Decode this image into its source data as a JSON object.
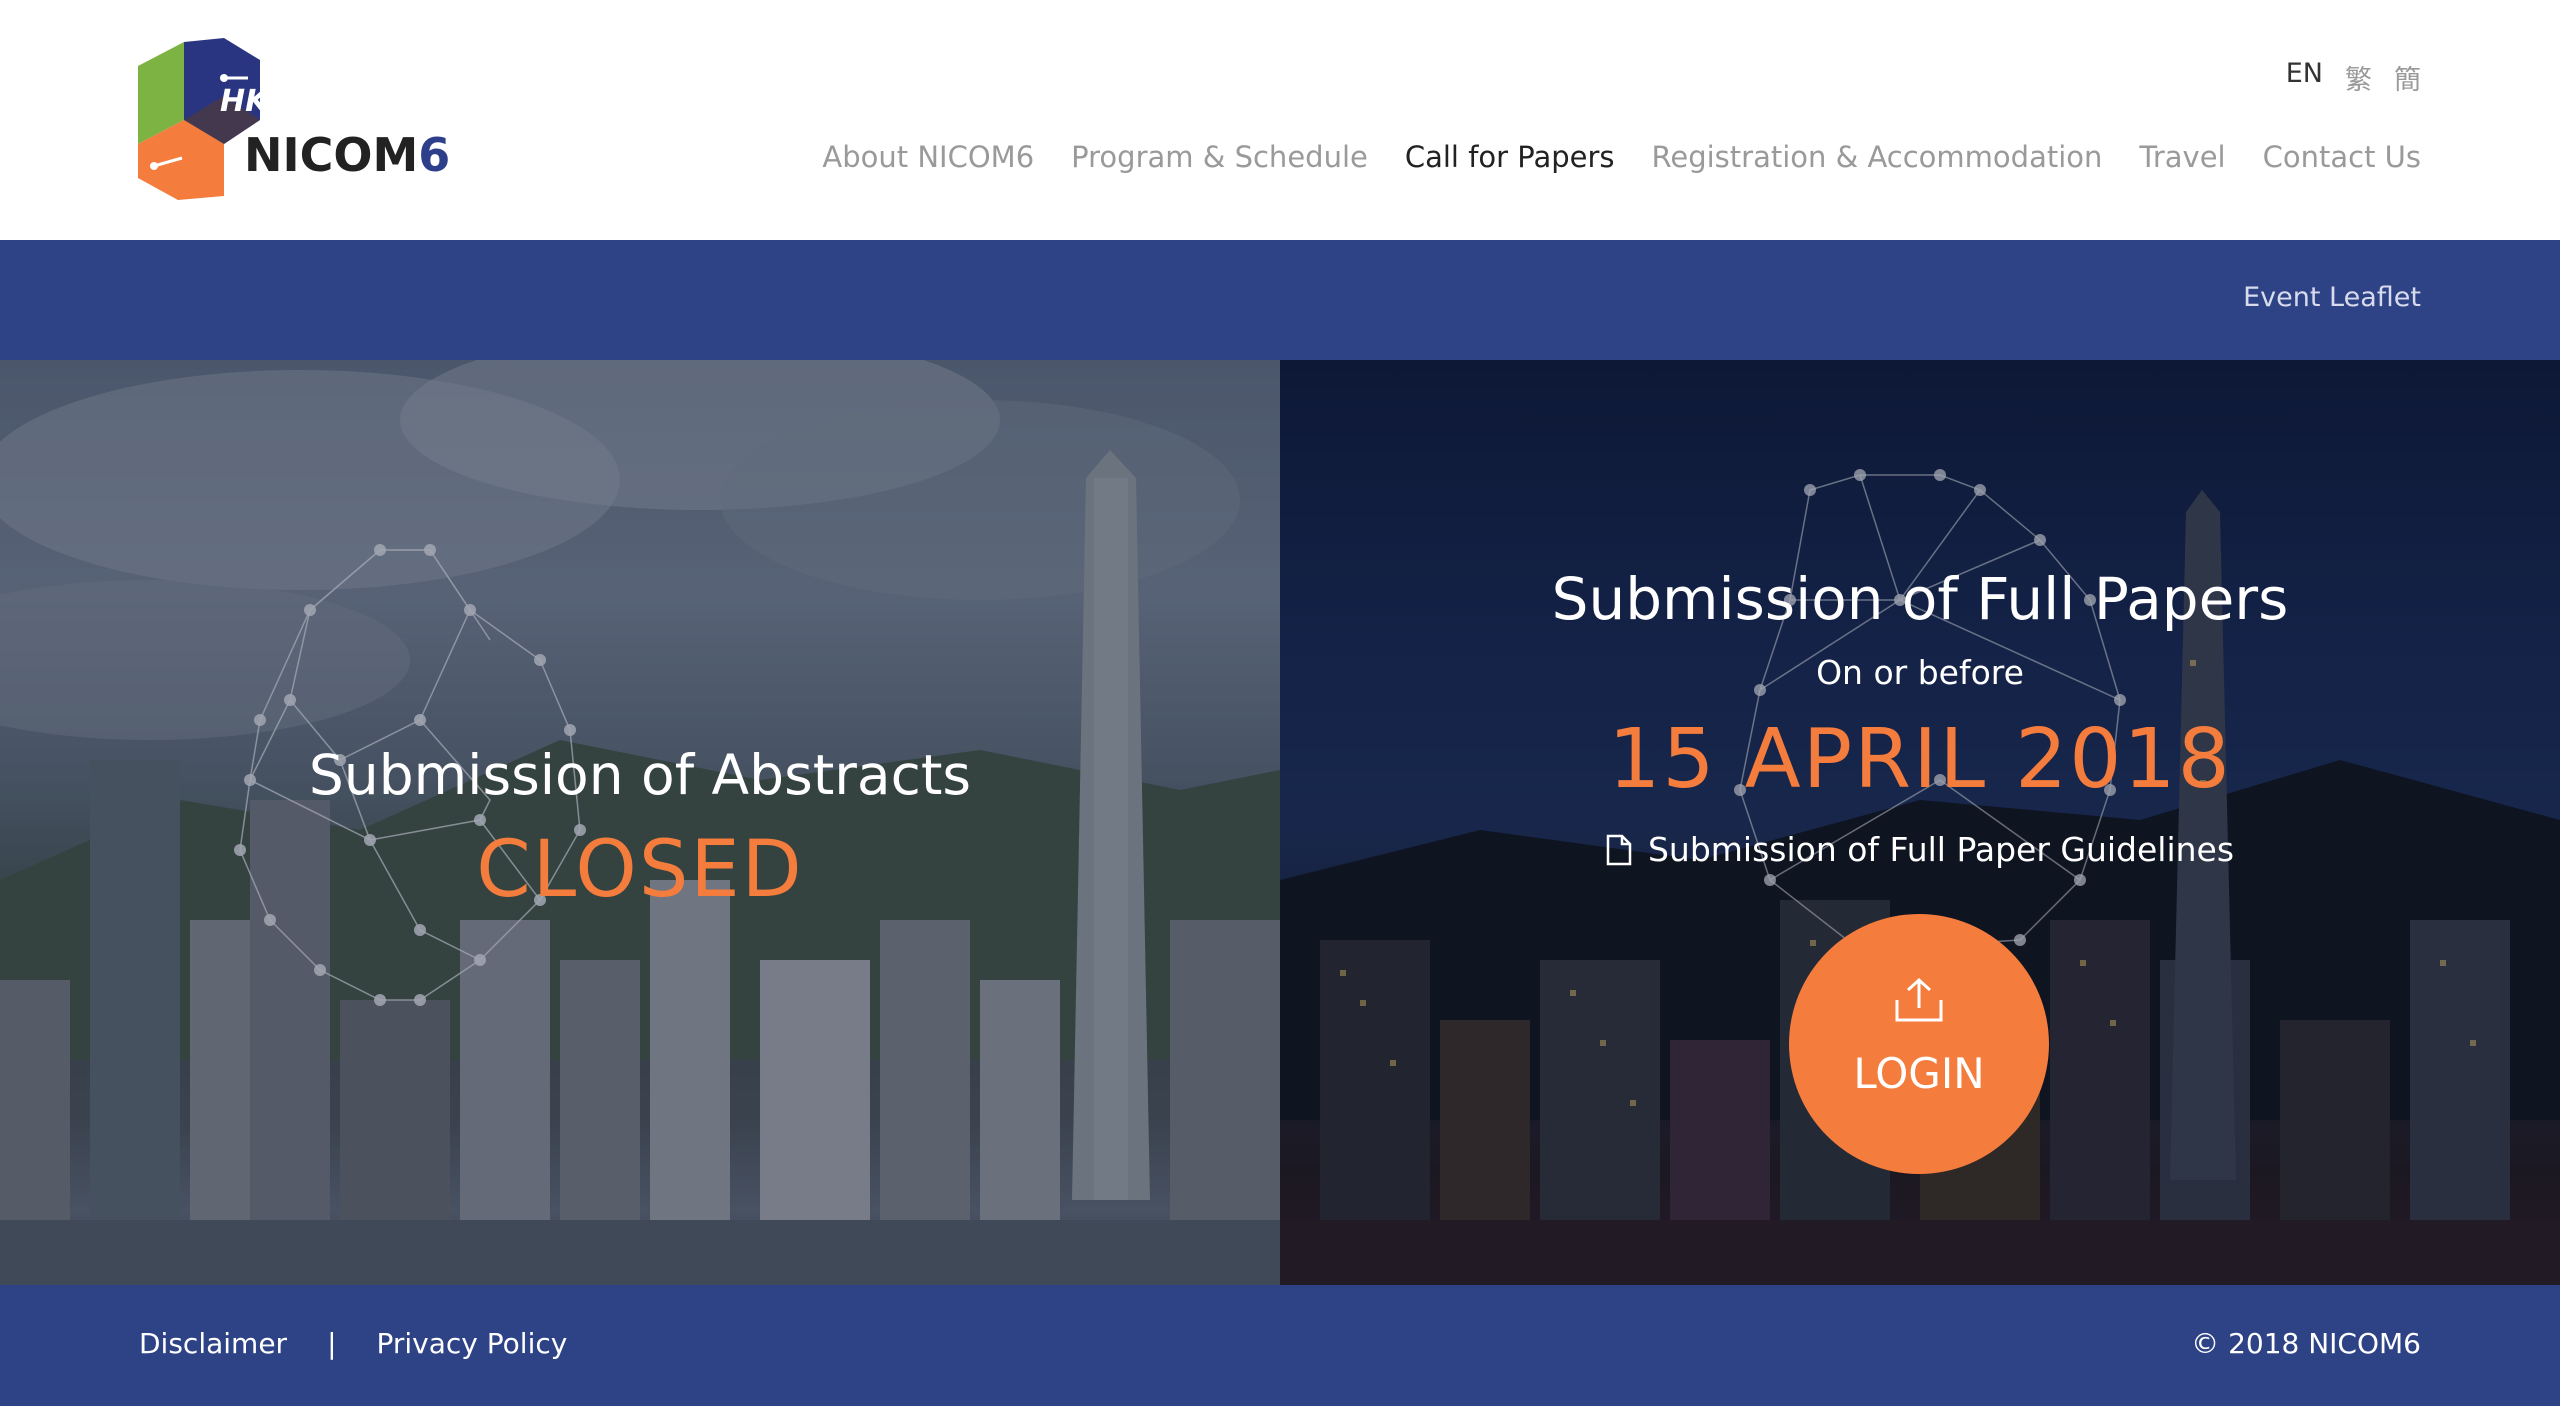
{
  "header": {
    "logo": {
      "badge": "HK",
      "name": "NICOM",
      "number": "6"
    },
    "languages": [
      {
        "label": "EN",
        "active": true
      },
      {
        "label": "繁",
        "active": false
      },
      {
        "label": "簡",
        "active": false
      }
    ],
    "nav": [
      {
        "label": "About NICOM6",
        "active": false
      },
      {
        "label": "Program & Schedule",
        "active": false
      },
      {
        "label": "Call for Papers",
        "active": true
      },
      {
        "label": "Registration & Accommodation",
        "active": false
      },
      {
        "label": "Travel",
        "active": false
      },
      {
        "label": "Contact Us",
        "active": false
      }
    ]
  },
  "subbar": {
    "link": "Event Leaflet"
  },
  "abstracts": {
    "title": "Submission of Abstracts",
    "status": "CLOSED"
  },
  "full_papers": {
    "title": "Submission of Full Papers",
    "subtitle": "On or before",
    "deadline": "15 APRIL 2018",
    "guidelines_link": "Submission of Full Paper Guidelines",
    "login_label": "LOGIN"
  },
  "footer": {
    "disclaimer": "Disclaimer",
    "separator": "|",
    "privacy": "Privacy Policy",
    "copyright": "© 2018 NICOM6"
  },
  "colors": {
    "brand_blue": "#2e4286",
    "accent_orange": "#f47c3c",
    "logo_green": "#7cb342",
    "logo_navy": "#2a3582"
  },
  "icons": [
    "document-icon",
    "upload-icon"
  ]
}
